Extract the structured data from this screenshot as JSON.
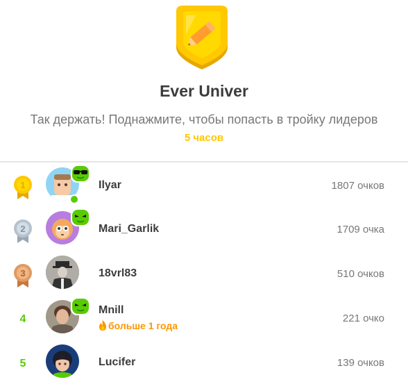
{
  "league": {
    "badge_icon": "gold-league-shield-pencil-icon",
    "title": "Ever Univer",
    "subtitle": "Так держать! Поднажмите, чтобы попасть в тройку лидеров",
    "time_left": "5 часов"
  },
  "colors": {
    "accent_green": "#58cc02",
    "timer_gold": "#ffc800",
    "streak_orange": "#ff9600",
    "text_gray": "#777777"
  },
  "leaderboard": [
    {
      "rank": "1",
      "rank_icon": "gold-medal-icon",
      "name": "Ilyar",
      "xp": "1807 очков",
      "sticker": "sunglasses-frog-icon",
      "online": true
    },
    {
      "rank": "2",
      "rank_icon": "silver-medal-icon",
      "name": "Mari_Garlik",
      "xp": "1709 очка",
      "sticker": "green-frog-icon",
      "online": false
    },
    {
      "rank": "3",
      "rank_icon": "bronze-medal-icon",
      "name": "18vrl83",
      "xp": "510 очков",
      "sticker": null,
      "online": false
    },
    {
      "rank": "4",
      "rank_icon": null,
      "name": "Mnill",
      "xp": "221 очко",
      "sticker": "green-frog-icon",
      "online": false,
      "streak": "больше 1 года"
    },
    {
      "rank": "5",
      "rank_icon": null,
      "name": "Lucifer",
      "xp": "139 очков",
      "sticker": null,
      "online": false
    }
  ]
}
